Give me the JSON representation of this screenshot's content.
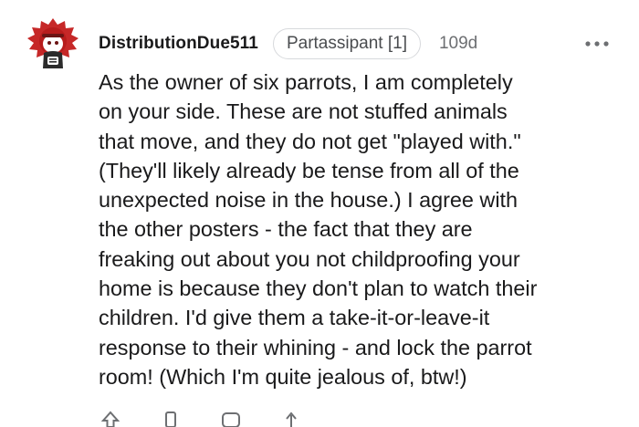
{
  "comment": {
    "author": "DistributionDue511",
    "flair": "Partassipant [1]",
    "age": "109d",
    "more_icon": "more-dots-icon",
    "body_lines": [
      "As the owner of six parrots, I am completely",
      "on your side. These are not stuffed animals",
      "that move, and they do not get \"played with.\"",
      "(They'll likely already be tense from all of the",
      "unexpected noise in the house.) I agree with",
      "the other posters - the fact that they are",
      "freaking out about you not childproofing your",
      "home is because they don't plan to watch their",
      "children. I'd give them a take-it-or-leave-it",
      "response to their whining - and lock the parrot",
      "room! (Which I'm quite jealous of, btw!)"
    ],
    "actions": [
      {
        "icon": "upvote-icon"
      },
      {
        "icon": "award-icon"
      },
      {
        "icon": "reply-icon"
      },
      {
        "icon": "share-icon"
      }
    ]
  },
  "colors": {
    "text": "#1a1a1b",
    "meta": "#6d6f72",
    "flair_border": "#d7d9dc",
    "avatar_red": "#c62828",
    "avatar_dark": "#6b1414"
  }
}
